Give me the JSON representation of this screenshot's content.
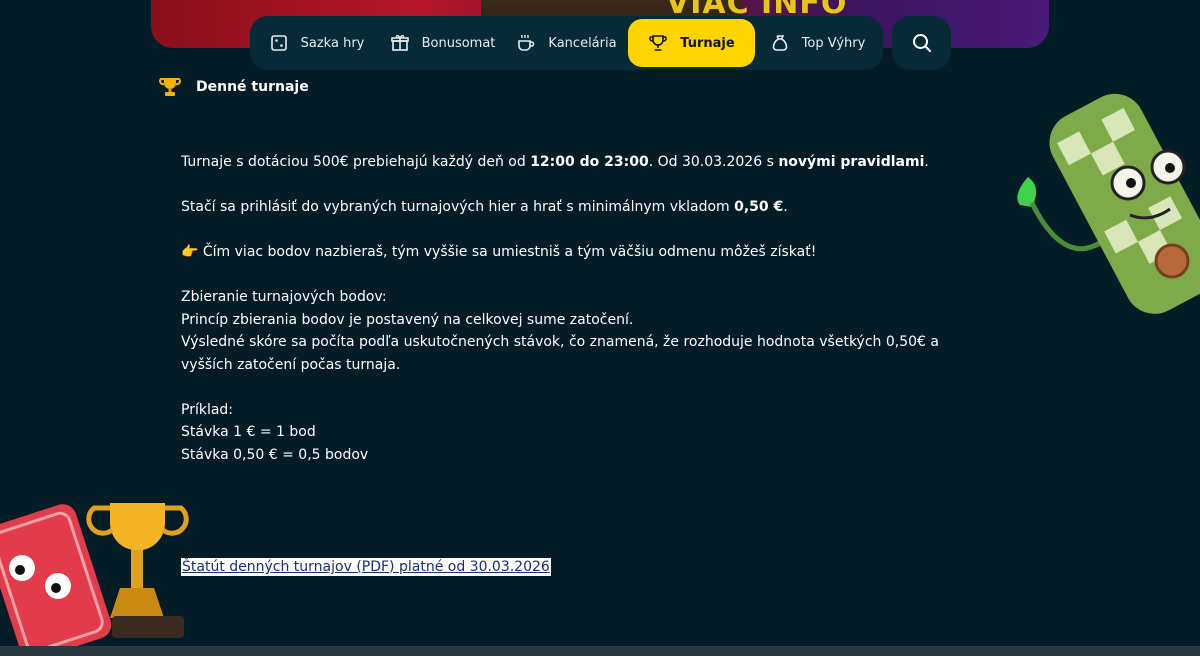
{
  "banner": {
    "text": "VIAC INFO"
  },
  "nav": {
    "items": [
      {
        "label": "Sazka hry",
        "icon": "dice-icon"
      },
      {
        "label": "Bonusomat",
        "icon": "gift-icon"
      },
      {
        "label": "Kancelária",
        "icon": "coffee-icon"
      },
      {
        "label": "Turnaje",
        "icon": "trophy-icon",
        "active": true
      },
      {
        "label": "Top Výhry",
        "icon": "money-bag-icon"
      }
    ],
    "search_icon": "search-icon",
    "active_color": "#ffd500"
  },
  "section": {
    "title": "Denné turnaje",
    "icon": "trophy-icon"
  },
  "content": {
    "p1_a": "Turnaje s dotáciou 500€ prebiehajú každý deň od ",
    "p1_b": "12:00 do 23:00",
    "p1_c": ". Od 30.03.2026 s ",
    "p1_d": "novými pravidlami",
    "p1_e": ".",
    "p2_a": "Stačí sa prihlásiť do vybraných turnajových hier a hrať s minimálnym vkladom ",
    "p2_b": "0,50 €",
    "p2_c": ".",
    "p3_emoji": "👉",
    "p3": " Čím viac bodov nazbieraš, tým vyššie sa umiestniš a tým väčšiu odmenu môžeš získať!",
    "p4_l1": "Zbieranie turnajových bodov:",
    "p4_l2": "Princíp zbierania bodov je postavený na celkovej sume zatočení.",
    "p4_l3": "Výsledné skóre sa počíta podľa uskutočnených stávok, čo znamená, že rozhoduje hodnota všetkých 0,50€ a vyšších zatočení počas turnaja.",
    "p5_l1": "Príklad:",
    "p5_l2": "Stávka 1 € = 1 bod",
    "p5_l3": "Stávka 0,50 € = 0,5 bodov"
  },
  "link": {
    "text": "Štatút denných turnajov (PDF) platné od 30.03.2026"
  },
  "colors": {
    "background": "#031c26",
    "nav_bg": "#062a36",
    "accent": "#ffd500",
    "link_text": "#1a2c74"
  }
}
